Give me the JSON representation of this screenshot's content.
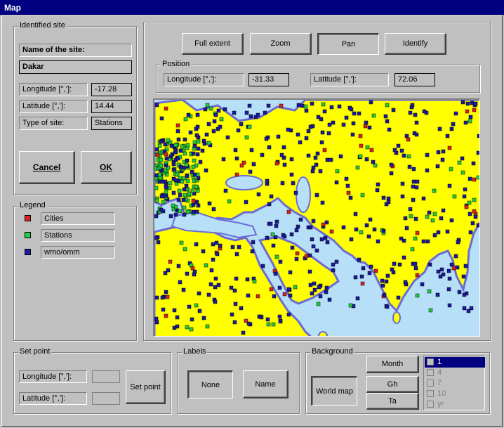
{
  "window": {
    "title": "Map"
  },
  "identified_site": {
    "group_title": "Identified site",
    "name_header": "Name of the site:",
    "name_value": "Dakar",
    "longitude_label": "Longitude [°,']:",
    "longitude_value": "-17.28",
    "latitude_label": "Latitude [°,']:",
    "latitude_value": "14.44",
    "type_label": "Type of site:",
    "type_value": "Stations",
    "cancel_label": "Cancel",
    "ok_label": "OK"
  },
  "legend": {
    "group_title": "Legend",
    "items": [
      {
        "label": "Cities",
        "color": "#e02020"
      },
      {
        "label": "Stations",
        "color": "#20d040"
      },
      {
        "label": "wmo/omm",
        "color": "#1a1aa0"
      }
    ]
  },
  "toolbar": {
    "full_extent_label": "Full extent",
    "zoom_label": "Zoom",
    "pan_label": "Pan",
    "identify_label": "Identify"
  },
  "position": {
    "group_title": "Position",
    "longitude_label": "Longitude [°,']:",
    "longitude_value": "-31.33",
    "latitude_label": "Latitude [°,']:",
    "latitude_value": "72.06"
  },
  "map_colors": {
    "sea": "#b7dff7",
    "land": "#ffff00",
    "coast_shadow": "#6b6bd6"
  },
  "set_point": {
    "group_title": "Set point",
    "longitude_label": "Longitude [°,']:",
    "longitude_value": "",
    "latitude_label": "Latitude [°,']:",
    "latitude_value": "",
    "button_label": "Set point"
  },
  "labels": {
    "group_title": "Labels",
    "none_label": "None",
    "name_label": "Name"
  },
  "background": {
    "group_title": "Background",
    "world_map_label": "World map",
    "month_label": "Month",
    "gh_label": "Gh",
    "ta_label": "Ta",
    "list_items": [
      "1",
      "4",
      "7",
      "10",
      "yr"
    ],
    "selected_index": 0
  }
}
